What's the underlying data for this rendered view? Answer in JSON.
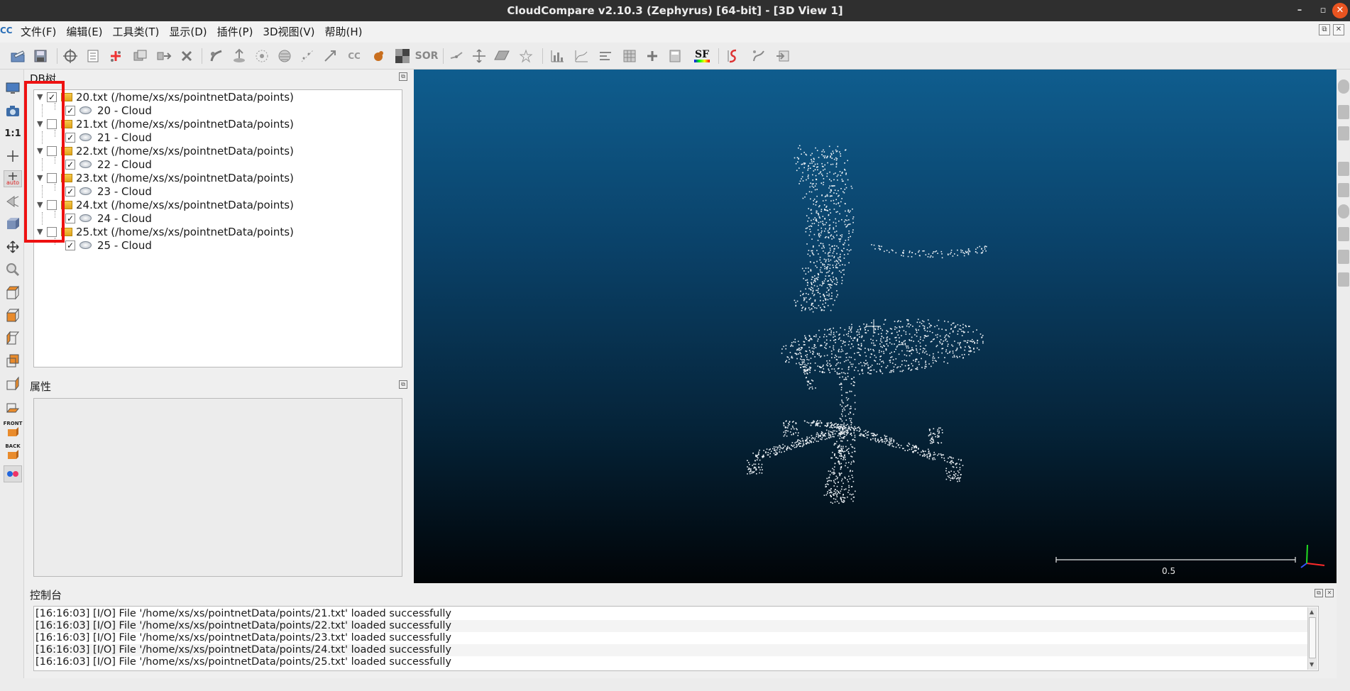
{
  "window": {
    "title": "CloudCompare v2.10.3 (Zephyrus) [64-bit] - [3D View 1]",
    "controls": [
      "–",
      "▫",
      "✕"
    ]
  },
  "menu": {
    "logo": "CC",
    "items": [
      "文件(F)",
      "编辑(E)",
      "工具类(T)",
      "显示(D)",
      "插件(P)",
      "3D视图(V)",
      "帮助(H)"
    ],
    "mdi_buttons": [
      "⧉",
      "✕"
    ]
  },
  "toolbar": {
    "sf_label": "SF",
    "sor_label": "SOR",
    "cc_label": "CC"
  },
  "left_toolbar": {
    "ratio_label": "1:1",
    "auto_label": "auto",
    "front_label": "FRONT",
    "back_label": "BACK"
  },
  "db_tree": {
    "title": "DB树",
    "entries": [
      {
        "file": "20.txt (/home/xs/xs/pointnetData/points)",
        "file_checked": "✓",
        "cloud": "20 - Cloud",
        "cloud_checked": "✓"
      },
      {
        "file": "21.txt (/home/xs/xs/pointnetData/points)",
        "file_checked": "",
        "cloud": "21 - Cloud",
        "cloud_checked": "✓"
      },
      {
        "file": "22.txt (/home/xs/xs/pointnetData/points)",
        "file_checked": "",
        "cloud": "22 - Cloud",
        "cloud_checked": "✓"
      },
      {
        "file": "23.txt (/home/xs/xs/pointnetData/points)",
        "file_checked": "",
        "cloud": "23 - Cloud",
        "cloud_checked": "✓"
      },
      {
        "file": "24.txt (/home/xs/xs/pointnetData/points)",
        "file_checked": "",
        "cloud": "24 - Cloud",
        "cloud_checked": "✓"
      },
      {
        "file": "25.txt (/home/xs/xs/pointnetData/points)",
        "file_checked": "",
        "cloud": "25 - Cloud",
        "cloud_checked": "✓"
      }
    ]
  },
  "properties": {
    "title": "属性"
  },
  "view3d": {
    "scale_label": "0.5",
    "axis_colors": {
      "x": "#ff2a2a",
      "y": "#22dd22",
      "z": "#3355ff"
    }
  },
  "console": {
    "title": "控制台",
    "lines": [
      "[16:16:03] [I/O] File '/home/xs/xs/pointnetData/points/21.txt' loaded successfully",
      "[16:16:03] [I/O] File '/home/xs/xs/pointnetData/points/22.txt' loaded successfully",
      "[16:16:03] [I/O] File '/home/xs/xs/pointnetData/points/23.txt' loaded successfully",
      "[16:16:03] [I/O] File '/home/xs/xs/pointnetData/points/24.txt' loaded successfully",
      "[16:16:03] [I/O] File '/home/xs/xs/pointnetData/points/25.txt' loaded successfully"
    ]
  },
  "annotation": {
    "highlight_color": "#ee1111"
  }
}
